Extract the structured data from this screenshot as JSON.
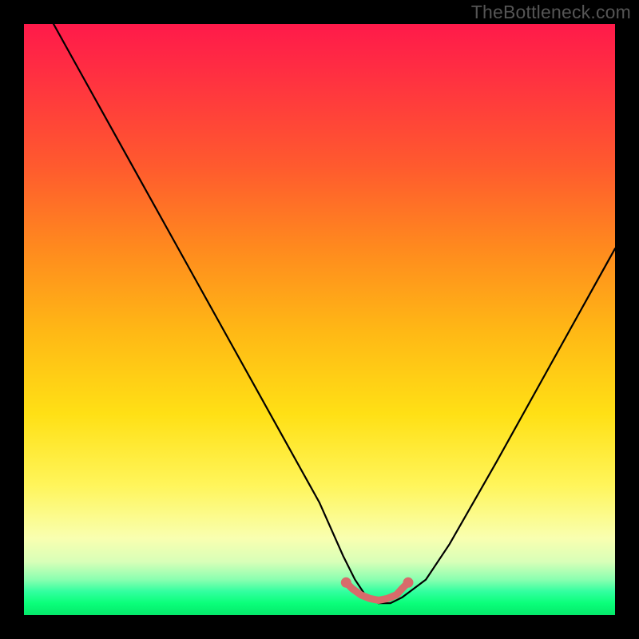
{
  "watermark": "TheBottleneck.com",
  "chart_data": {
    "type": "line",
    "title": "",
    "xlabel": "",
    "ylabel": "",
    "xlim": [
      0,
      100
    ],
    "ylim": [
      0,
      100
    ],
    "grid": false,
    "legend": false,
    "series": [
      {
        "name": "bottleneck-curve",
        "x": [
          5,
          10,
          15,
          20,
          25,
          30,
          35,
          40,
          45,
          50,
          54,
          56,
          58,
          60,
          62,
          64,
          68,
          72,
          76,
          80,
          85,
          90,
          95,
          100
        ],
        "y": [
          100,
          91,
          82,
          73,
          64,
          55,
          46,
          37,
          28,
          19,
          10,
          6,
          3,
          2,
          2,
          3,
          6,
          12,
          19,
          26,
          35,
          44,
          53,
          62
        ]
      },
      {
        "name": "low-bottleneck-band",
        "x": [
          54.5,
          55.5,
          57,
          58.5,
          60,
          61.5,
          63,
          64,
          65
        ],
        "y": [
          5.5,
          4.5,
          3.4,
          2.8,
          2.5,
          2.8,
          3.4,
          4.5,
          5.5
        ]
      }
    ],
    "annotations": [],
    "colors": {
      "curve": "#000000",
      "band_stroke": "#d86b6b",
      "band_dot_fill": "#d86b6b",
      "gradient_top": "#ff1a4a",
      "gradient_bottom": "#05e86b"
    }
  }
}
